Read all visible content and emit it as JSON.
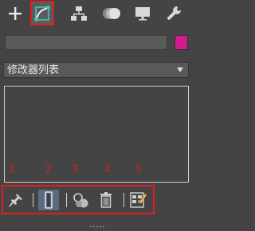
{
  "tabs": [
    {
      "icon": "plus-icon",
      "name": "create"
    },
    {
      "icon": "modify-curve-icon",
      "name": "modify",
      "active": true
    },
    {
      "icon": "hierarchy-icon",
      "name": "hierarchy"
    },
    {
      "icon": "motion-icon",
      "name": "motion"
    },
    {
      "icon": "display-monitor-icon",
      "name": "display"
    },
    {
      "icon": "wrench-icon",
      "name": "utilities"
    }
  ],
  "object": {
    "name_value": "",
    "color": "#ce1d8f"
  },
  "modifier_list": {
    "label": "修改器列表"
  },
  "annotations": [
    "1",
    "2",
    "3",
    "4",
    "5"
  ],
  "toolbar": [
    {
      "icon": "pin-stack-icon"
    },
    {
      "icon": "show-end-result-icon",
      "active": true
    },
    {
      "icon": "make-unique-icon"
    },
    {
      "icon": "trash-icon"
    },
    {
      "icon": "configure-modifier-sets-icon"
    }
  ],
  "colors": {
    "highlight": "#e01f1f",
    "panel_bg": "#444444",
    "active_tab": "#5b5b5b"
  }
}
